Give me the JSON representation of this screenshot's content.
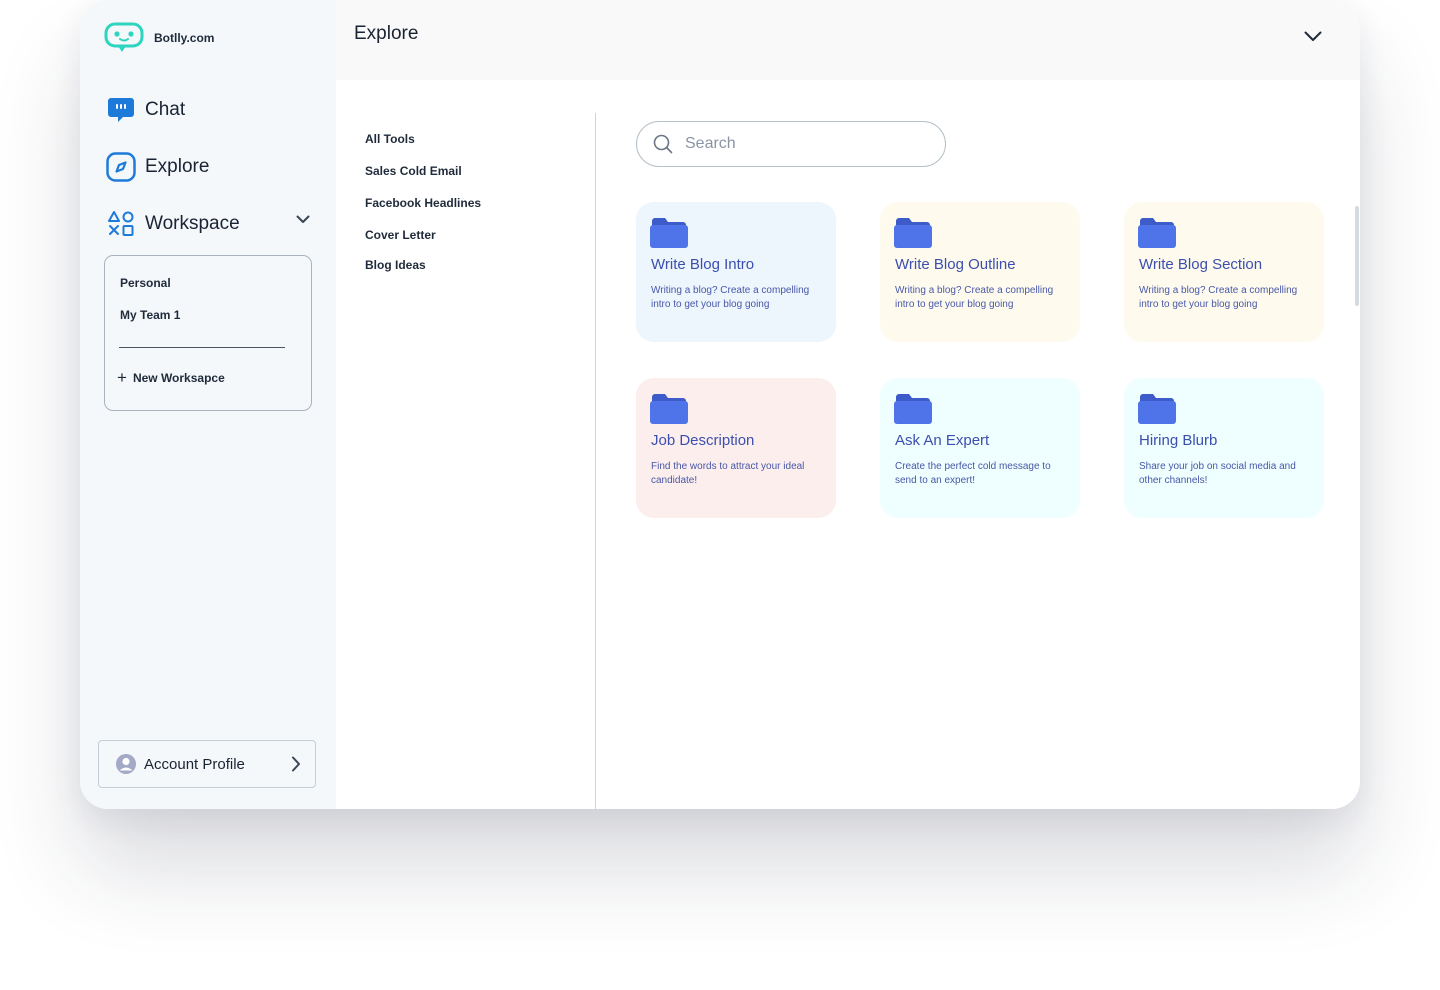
{
  "brand": {
    "name": "Botlly.com"
  },
  "sidebar": {
    "nav": [
      {
        "label": "Chat",
        "icon": "chat-bubble-icon"
      },
      {
        "label": "Explore",
        "icon": "compass-icon"
      },
      {
        "label": "Workspace",
        "icon": "shapes-icon"
      }
    ],
    "workspaces": {
      "items": [
        "Personal",
        "My Team 1"
      ],
      "new_label": "New Worksapce"
    },
    "account": {
      "label": "Account Profile"
    }
  },
  "header": {
    "title": "Explore"
  },
  "tools": {
    "items": [
      "All Tools",
      "Sales Cold Email",
      "Facebook Headlines",
      "Cover Letter",
      "Blog Ideas"
    ]
  },
  "search": {
    "placeholder": "Search"
  },
  "cards": [
    {
      "title": "Write Blog Intro",
      "desc": "Writing a blog? Create a compelling intro to get your blog going",
      "bg": "#edf5fd"
    },
    {
      "title": "Write Blog Outline",
      "desc": "Writing a blog? Create a compelling intro to get your blog going",
      "bg": "#fefbee"
    },
    {
      "title": "Write Blog Section",
      "desc": "Writing a blog? Create a compelling intro to get your blog going",
      "bg": "#fefbee"
    },
    {
      "title": "Job Description",
      "desc": "Find the words to attract your ideal candidate!",
      "bg": "#fdeeee"
    },
    {
      "title": "Ask An Expert",
      "desc": "Create the perfect cold message to send to an expert!",
      "bg": "#effefe"
    },
    {
      "title": "Hiring Blurb",
      "desc": "Share your job on social media and other channels!",
      "bg": "#effefe"
    }
  ],
  "colors": {
    "accent": "#1e7ad9",
    "folder": "#4f73e8",
    "logo": "#2dd4bf"
  }
}
